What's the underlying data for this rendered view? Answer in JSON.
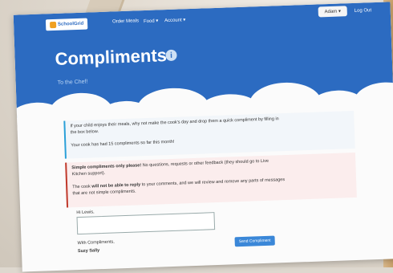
{
  "app": {
    "logo": "SchoolGrid"
  },
  "nav": {
    "items": [
      "Order Meals",
      "Food ▾",
      "Account ▾"
    ],
    "user": "Adam ▾",
    "logout": "Log Out"
  },
  "header": {
    "title": "Compliments",
    "subtitle": "To the Chef!"
  },
  "info": {
    "line1": "If your child enjoys their meals, why not make the cook's day and drop them a quick compliment by filling in",
    "line1b": "the box below.",
    "line2": "Your cook has had 15 compliments so far this month!"
  },
  "warning": {
    "bold1": "Simple compliments only please!",
    "text1": " No questions, requests or other feedback (they should go to Live",
    "text1b": "Kitchen support).",
    "text2a": "The cook ",
    "bold2": "will not be able to reply",
    "text2b": " to your comments, and we will review and remove any parts of messages",
    "text2c": "that are not simple compliments."
  },
  "form": {
    "greeting": "Hi Lewis,",
    "signoff": "With Compliments,",
    "name": "Suzy Sally",
    "send": "Send Compliment"
  }
}
